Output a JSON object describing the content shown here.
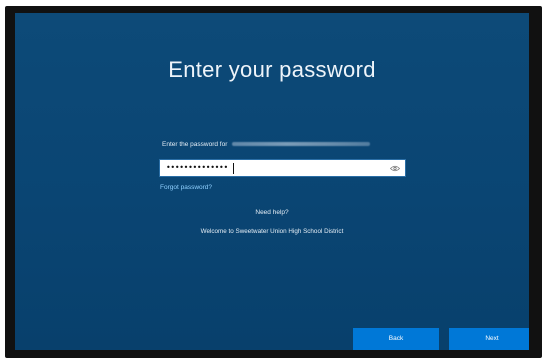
{
  "screen": {
    "title": "Enter your password",
    "prompt": "Enter the password for",
    "password_mask": "••••••••••••••",
    "forgot_password": "Forgot password?",
    "need_help": "Need help?",
    "welcome": "Welcome to Sweetwater Union High School District"
  },
  "buttons": {
    "back": "Back",
    "next": "Next"
  },
  "icons": {
    "reveal": "eye-icon"
  },
  "colors": {
    "background": "#0a4573",
    "accent_button": "#0078d7",
    "link": "#8fd0ff"
  }
}
